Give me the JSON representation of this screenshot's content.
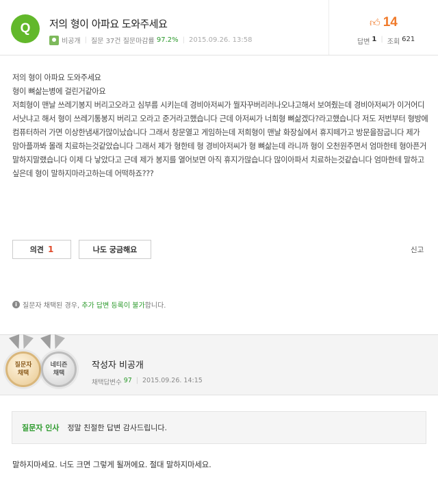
{
  "question": {
    "badge": "Q",
    "title": "저의 형이 아파요 도와주세요",
    "author": "비공개",
    "question_count": "질문 37건",
    "close_rate_label": "질문마감률",
    "close_rate": "97.2%",
    "date": "2015.09.26. 13:58",
    "likes": "14",
    "answers_label": "답변",
    "answers": "1",
    "views_label": "조회",
    "views": "621",
    "body_lines": [
      "저의 형이 아파요 도와주세요",
      "형이 뼈삶는병에 걸린거같아요",
      "저희형이 맨날 쓰레기봉지 버리고오라고 심부름 시키는데 경비아저씨가 뭘자꾸버리러나오냐고해서 보여줬는데 경비아저씨가 이거어디서낫냐고 해서 형이 쓰레기통봉지 버리고 오라고 준거라고했습니다 근데 아저씨가 너희형 뼈삶겠다?라고했습니다 저도 저번부터 형방에 컴퓨터하러 가면 이상한냄새가많이났습니다 그래서 창문열고 게임하는데 저희형이 맨날 화장실에서 휴지떼가고 방문을잠굽니다 제가 맘아플까봐 몰래 치료하는것같았습니다 그래서 제가 형한테 형 경비아저씨가 형 뼈삶는데 라니까 형이 오천원주면서 엄마한테 형아픈거 말하지말랬습니다 이제 다 낳았다고 근데 제가 봉지를 열어보면 아직 휴지가많습니다 많이아파서 치료하는것같습니다 엄마한테 말하고싶은데 형이 말하지마라고하는데 어떡하죠???"
    ]
  },
  "actions": {
    "opinion_label": "의견",
    "opinion_count": "1",
    "curious_label": "나도 궁금해요",
    "report_label": "신고"
  },
  "notice": {
    "prefix": "질문자 채택된 경우,",
    "highlight": "추가 답변 등록이 불가",
    "suffix": "합니다."
  },
  "answer": {
    "medal1": [
      "질문자",
      "채택"
    ],
    "medal2": [
      "네티즌",
      "채택"
    ],
    "writer": "작성자 비공개",
    "chosen_label": "채택답변수",
    "chosen_count": "97",
    "date": "2015.09.26. 14:15",
    "greet_label": "질문자 인사",
    "greet_msg": "정말 친절한 답변 감사드립니다.",
    "text": "말하지마세요. 너도 크면 그렇게 될꺼에요. 절대 말하지마세요."
  },
  "colors": {
    "brand_green": "#62b82b",
    "accent_orange": "#f07a2a",
    "count_red": "#e04a2a"
  }
}
